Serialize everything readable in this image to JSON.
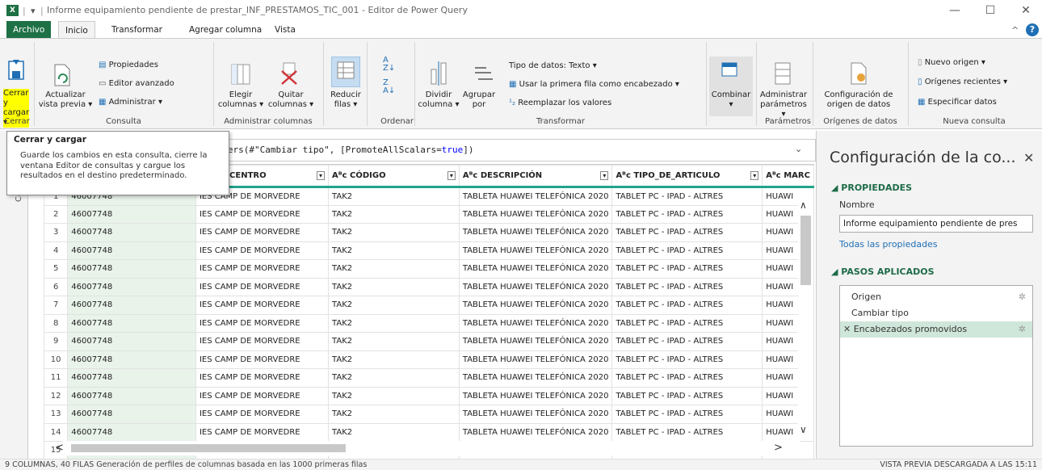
{
  "window": {
    "title": "Informe equipamiento pendiente de prestar_INF_PRESTAMOS_TIC_001 - Editor de Power Query",
    "app_icon": "X",
    "min": "—",
    "max": "☐",
    "close": "✕"
  },
  "tabs": [
    "Archivo",
    "Inicio",
    "Transformar",
    "Agregar columna",
    "Vista"
  ],
  "ribbon": {
    "cerrar": {
      "label1": "Cerrar y",
      "label2": "cargar ▾",
      "group": "Cerrar"
    },
    "consulta": {
      "actualizar1": "Actualizar",
      "actualizar2": "vista previa ▾",
      "propiedades": "Propiedades",
      "editor": "Editor avanzado",
      "administrar": "Administrar ▾",
      "group": "Consulta"
    },
    "columnas": {
      "elegir1": "Elegir",
      "elegir2": "columnas ▾",
      "quitar1": "Quitar",
      "quitar2": "columnas ▾",
      "group": "Administrar columnas"
    },
    "reducir": {
      "label1": "Reducir",
      "label2": "filas ▾"
    },
    "ordenar": {
      "group": "Ordenar"
    },
    "transformar": {
      "dividir1": "Dividir",
      "dividir2": "columna ▾",
      "agrupar1": "Agrupar",
      "agrupar2": "por",
      "tipo": "Tipo de datos: Texto ▾",
      "primera_fila": "Usar la primera fila como encabezado ▾",
      "reemplazar": "Reemplazar los valores",
      "group": "Transformar"
    },
    "combinar": {
      "label1": "Combinar",
      "label2": "▾"
    },
    "parametros": {
      "label1": "Administrar",
      "label2": "parámetros ▾",
      "group": "Parámetros"
    },
    "origenes": {
      "label1": "Configuración de",
      "label2": "origen de datos",
      "group": "Orígenes de datos"
    },
    "nueva": {
      "nuevo": "Nuevo origen ▾",
      "recientes": "Orígenes recientes ▾",
      "especificar": "Especificar datos",
      "group": "Nueva consulta"
    }
  },
  "tooltip": {
    "title": "Cerrar y cargar",
    "body": [
      "Guarde los cambios en esta consulta, cierre la",
      "ventana Editor de consultas y cargue los",
      "resultados en el destino predeterminado."
    ]
  },
  "formula": {
    "text1": "eaders(#\"Cambiar tipo\", [PromoteAllScalars=",
    "kw": "true",
    "text2": "])"
  },
  "left_label": "Con",
  "grid": {
    "headers": [
      "",
      "",
      "MBRE_CENTRO",
      "Aᴮc CÓDIGO",
      "Aᴮc DESCRIPCIÓN",
      "Aᴮc TIPO_DE_ARTICULO",
      "Aᴮc MARC"
    ],
    "rows": [
      [
        "1",
        "46007748",
        "IES CAMP DE MORVEDRE",
        "TAK2",
        "TABLETA HUAWEI TELEFÓNICA 2020",
        "TABLET PC - IPAD - ALTRES",
        "HUAWI"
      ],
      [
        "2",
        "46007748",
        "IES CAMP DE MORVEDRE",
        "TAK2",
        "TABLETA HUAWEI TELEFÓNICA 2020",
        "TABLET PC - IPAD - ALTRES",
        "HUAWI"
      ],
      [
        "3",
        "46007748",
        "IES CAMP DE MORVEDRE",
        "TAK2",
        "TABLETA HUAWEI TELEFÓNICA 2020",
        "TABLET PC - IPAD - ALTRES",
        "HUAWI"
      ],
      [
        "4",
        "46007748",
        "IES CAMP DE MORVEDRE",
        "TAK2",
        "TABLETA HUAWEI TELEFÓNICA 2020",
        "TABLET PC - IPAD - ALTRES",
        "HUAWI"
      ],
      [
        "5",
        "46007748",
        "IES CAMP DE MORVEDRE",
        "TAK2",
        "TABLETA HUAWEI TELEFÓNICA 2020",
        "TABLET PC - IPAD - ALTRES",
        "HUAWI"
      ],
      [
        "6",
        "46007748",
        "IES CAMP DE MORVEDRE",
        "TAK2",
        "TABLETA HUAWEI TELEFÓNICA 2020",
        "TABLET PC - IPAD - ALTRES",
        "HUAWI"
      ],
      [
        "7",
        "46007748",
        "IES CAMP DE MORVEDRE",
        "TAK2",
        "TABLETA HUAWEI TELEFÓNICA 2020",
        "TABLET PC - IPAD - ALTRES",
        "HUAWI"
      ],
      [
        "8",
        "46007748",
        "IES CAMP DE MORVEDRE",
        "TAK2",
        "TABLETA HUAWEI TELEFÓNICA 2020",
        "TABLET PC - IPAD - ALTRES",
        "HUAWI"
      ],
      [
        "9",
        "46007748",
        "IES CAMP DE MORVEDRE",
        "TAK2",
        "TABLETA HUAWEI TELEFÓNICA 2020",
        "TABLET PC - IPAD - ALTRES",
        "HUAWI"
      ],
      [
        "10",
        "46007748",
        "IES CAMP DE MORVEDRE",
        "TAK2",
        "TABLETA HUAWEI TELEFÓNICA 2020",
        "TABLET PC - IPAD - ALTRES",
        "HUAWI"
      ],
      [
        "11",
        "46007748",
        "IES CAMP DE MORVEDRE",
        "TAK2",
        "TABLETA HUAWEI TELEFÓNICA 2020",
        "TABLET PC - IPAD - ALTRES",
        "HUAWI"
      ],
      [
        "12",
        "46007748",
        "IES CAMP DE MORVEDRE",
        "TAK2",
        "TABLETA HUAWEI TELEFÓNICA 2020",
        "TABLET PC - IPAD - ALTRES",
        "HUAWI"
      ],
      [
        "13",
        "46007748",
        "IES CAMP DE MORVEDRE",
        "TAK2",
        "TABLETA HUAWEI TELEFÓNICA 2020",
        "TABLET PC - IPAD - ALTRES",
        "HUAWI"
      ],
      [
        "14",
        "46007748",
        "IES CAMP DE MORVEDRE",
        "TAK2",
        "TABLETA HUAWEI TELEFÓNICA 2020",
        "TABLET PC - IPAD - ALTRES",
        "HUAWI"
      ],
      [
        "15",
        "",
        "",
        "",
        "",
        "",
        ""
      ]
    ]
  },
  "panel": {
    "title": "Configuración de la co...",
    "close": "✕",
    "propiedades": "◢ PROPIEDADES",
    "nombre_label": "Nombre",
    "nombre_value": "Informe equipamiento pendiente de pres",
    "todas": "Todas las propiedades",
    "pasos": "◢ PASOS APLICADOS",
    "steps": [
      "Origen",
      "Cambiar tipo",
      "Encabezados promovidos"
    ]
  },
  "status": {
    "left": "9 COLUMNAS, 40 FILAS   Generación de perfiles de columnas basada en las 1000 primeras filas",
    "right": "VISTA PREVIA DESCARGADA A LAS 15:11"
  },
  "colors": {
    "excel_green": "#1e7145",
    "accent_teal": "#1fa38a",
    "highlight": "#ffff00"
  }
}
